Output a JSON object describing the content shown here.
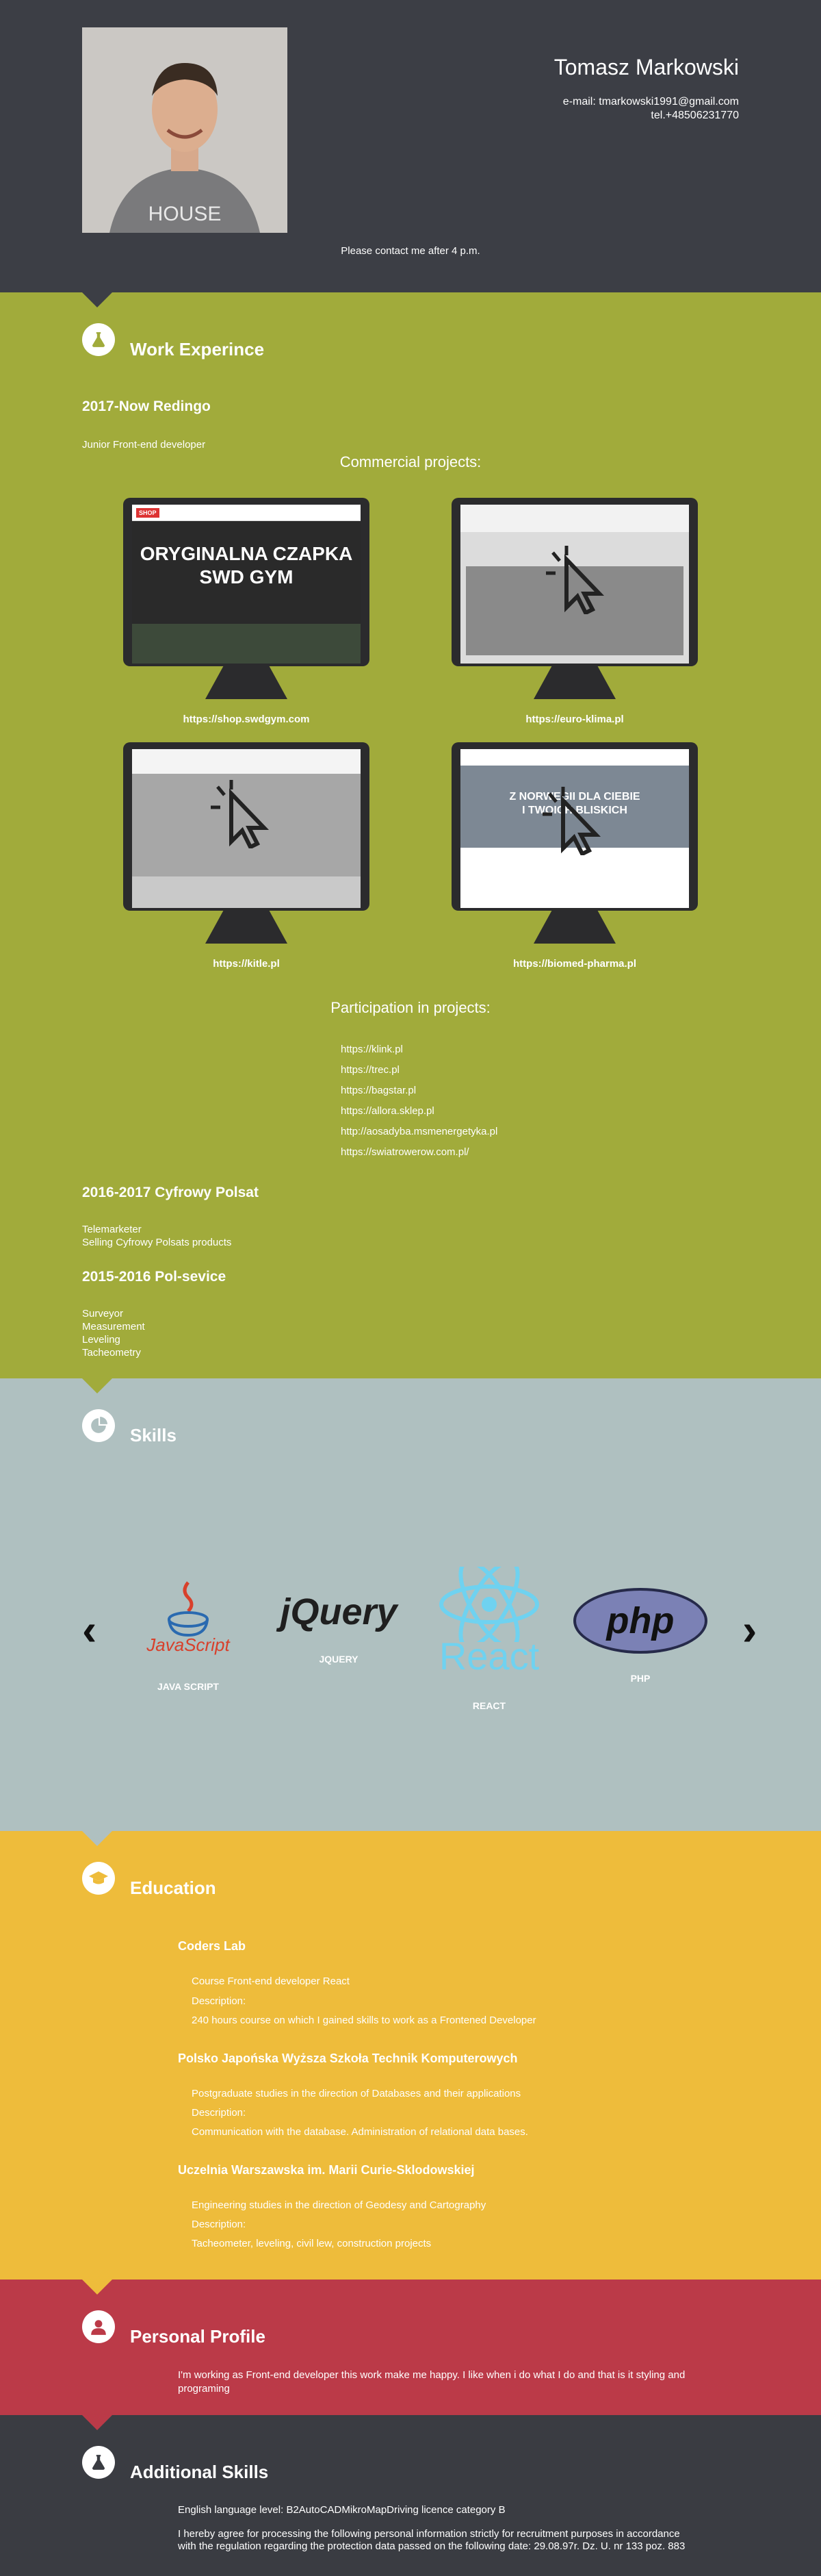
{
  "header": {
    "name": "Tomasz Markowski",
    "email": "e-mail: tmarkowski1991@gmail.com",
    "phone": "tel.+48506231770",
    "contact_note": "Please contact me after 4 p.m.",
    "photo_shirt_text": "HOUSE"
  },
  "work": {
    "icon": "flask-icon",
    "title": "Work Experince",
    "job1": {
      "title": "2017-Now Redingo",
      "role": "Junior Front-end developer"
    },
    "commercial_title": "Commercial projects:",
    "projects": [
      {
        "url": "https://shop.swdgym.com",
        "screen_text": "ORYGINALNA CZAPKA SWD GYM"
      },
      {
        "url": "https://euro-klima.pl",
        "screen_text": ""
      },
      {
        "url": "https://kitle.pl",
        "screen_text": ""
      },
      {
        "url": "https://biomed-pharma.pl",
        "screen_text": "Z NORWEGII DLA CIEBIE I TWOICH BLISKICH"
      }
    ],
    "participation_title": "Participation in projects:",
    "participation": [
      "https://klink.pl",
      "https://trec.pl",
      "https://bagstar.pl",
      "https://allora.sklep.pl",
      "http://aosadyba.msmenergetyka.pl",
      "https://swiatrowerow.com.pl/"
    ],
    "job2": {
      "title": "2016-2017 Cyfrowy Polsat",
      "line1": "Telemarketer",
      "line2": "Selling Cyfrowy Polsats products"
    },
    "job3": {
      "title": "2015-2016 Pol-sevice",
      "line1": "Surveyor",
      "line2": "Measurement",
      "line3": "Leveling",
      "line4": "Tacheometry"
    }
  },
  "skills": {
    "icon": "pie-chart-icon",
    "title": "Skills",
    "items": [
      {
        "logo": "JavaScript",
        "label": "JAVA SCRIPT"
      },
      {
        "logo": "jQuery",
        "label": "JQUERY"
      },
      {
        "logo": "React",
        "label": "REACT"
      },
      {
        "logo": "php",
        "label": "PHP"
      }
    ],
    "prev": "‹",
    "next": "›"
  },
  "education": {
    "icon": "graduation-cap-icon",
    "title": "Education",
    "schools": [
      {
        "name": "Coders Lab",
        "course": "Course Front-end developer React",
        "desc_label": "Description:",
        "desc": "240 hours course on which I gained skills to work as a Frontened Developer"
      },
      {
        "name": "Polsko Japońska Wyższa Szkoła Technik Komputerowych",
        "course": "Postgraduate studies in the direction of Databases and their applications",
        "desc_label": "Description:",
        "desc": "Communication with the database. Administration of relational data bases."
      },
      {
        "name": "Uczelnia Warszawska im. Marii Curie-Sklodowskiej",
        "course": "Engineering studies in the direction of Geodesy and Cartography",
        "desc_label": "Description:",
        "desc": "Tacheometer, leveling, civil lew, construction projects"
      }
    ]
  },
  "profile": {
    "icon": "user-icon",
    "title": "Personal Profile",
    "text": "I'm working as Front-end developer this work make me happy. I like when i do what I do and that is it styling and programing"
  },
  "additional": {
    "icon": "flask-icon",
    "title": "Additional Skills",
    "line1": "English language level: B2AutoCADMikroMapDriving licence category B",
    "line2": "I hereby agree for processing the following personal information strictly for recruitment purposes in accordance",
    "line3": "with the regulation regarding the protection data passed on the following date: 29.08.97r. Dz. U. nr 133 poz. 883"
  },
  "colors": {
    "header": "#3c3e45",
    "work": "#a1ab3b",
    "skills": "#afc0c0",
    "education": "#eebc3b",
    "profile": "#bb3a48",
    "additional": "#3a3c42"
  }
}
